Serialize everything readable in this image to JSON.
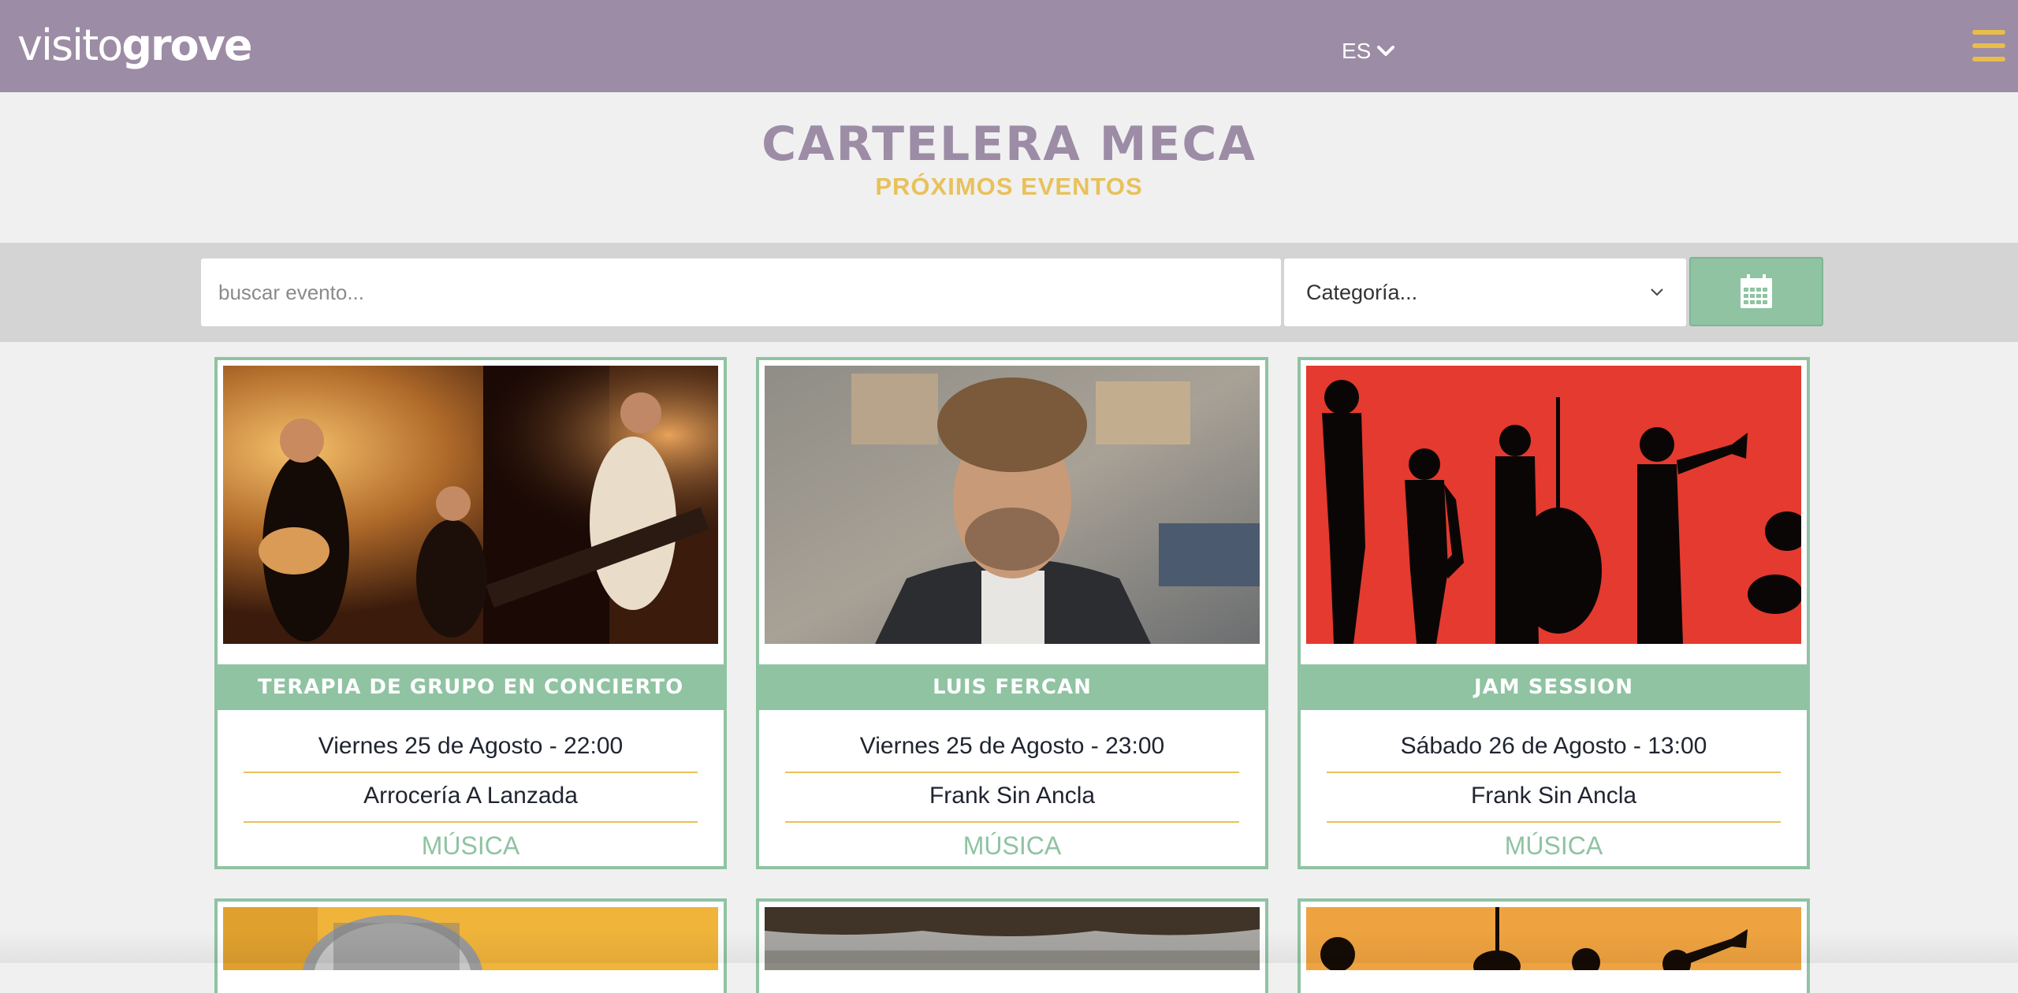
{
  "header": {
    "logo_part1": "visito",
    "logo_part2": "grove",
    "language": "ES",
    "menu_icon": "hamburger-icon"
  },
  "page": {
    "title": "CARTELERA MECA",
    "subtitle": "PRÓXIMOS EVENTOS"
  },
  "search": {
    "placeholder": "buscar evento...",
    "category_value": "Categoría...",
    "calendar_icon": "calendar-icon"
  },
  "events": [
    {
      "name": "TERAPIA DE GRUPO EN CONCIERTO",
      "date": "Viernes 25 de Agosto - 22:00",
      "venue": "Arrocería A Lanzada",
      "category": "MÚSICA"
    },
    {
      "name": "LUIS FERCAN",
      "date": "Viernes 25 de Agosto - 23:00",
      "venue": "Frank Sin Ancla",
      "category": "MÚSICA"
    },
    {
      "name": "JAM SESSION",
      "date": "Sábado 26 de Agosto - 13:00",
      "venue": "Frank Sin Ancla",
      "category": "MÚSICA"
    }
  ],
  "colors": {
    "header_bg": "#9c8ca5",
    "accent_green": "#8fc3a2",
    "accent_yellow": "#e8c15a",
    "page_bg": "#f0f0f0"
  }
}
